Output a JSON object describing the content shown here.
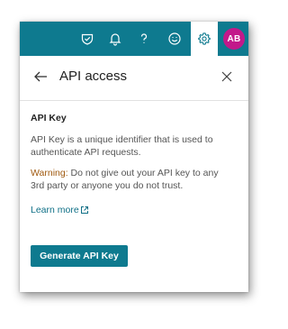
{
  "topbar": {
    "icons": [
      "shield-icon",
      "bell-icon",
      "help-icon",
      "smiley-icon",
      "gear-icon"
    ],
    "avatar_initials": "AB",
    "colors": {
      "bar": "#0e7a8f",
      "avatar": "#c2198a"
    }
  },
  "panel": {
    "title": "API access",
    "back_icon": "arrow-left-icon",
    "close_icon": "close-icon"
  },
  "api_key": {
    "heading": "API Key",
    "description": "API Key is a unique identifier that is used to authenticate API requests.",
    "warning_label": "Warning:",
    "warning_text": " Do not give out your API key to any 3rd party or anyone you do not trust.",
    "learn_more": "Learn more",
    "generate_button": "Generate API Key"
  }
}
